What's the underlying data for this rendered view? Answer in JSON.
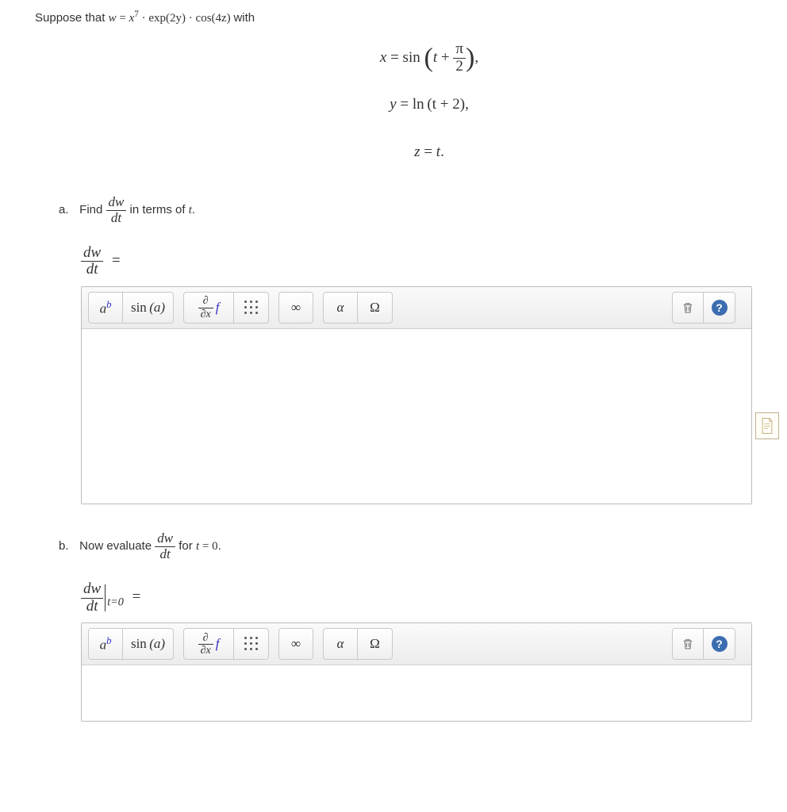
{
  "intro": {
    "prefix": "Suppose that ",
    "equation_lhs": "w",
    "equals": " = ",
    "rhs_x": "x",
    "rhs_sup": "7",
    "rhs_dot1": " · ",
    "rhs_exp": "exp",
    "rhs_exp_arg": "(2y)",
    "rhs_dot2": " · ",
    "rhs_cos": "cos",
    "rhs_cos_arg": "(4z)",
    "suffix": " with"
  },
  "equations": {
    "x_line": {
      "lhs": "x",
      "eq": " = ",
      "sin": "sin",
      "open": "(",
      "t": "t",
      "plus": " + ",
      "frac_num": "π",
      "frac_den": "2",
      "close": ")",
      "comma": ","
    },
    "y_line": {
      "lhs": "y",
      "eq": " = ",
      "ln": "ln",
      "arg": "(t + 2)",
      "comma": ","
    },
    "z_line": {
      "lhs": "z",
      "eq": " = ",
      "rhs": "t",
      "period": "."
    }
  },
  "part_a": {
    "label": "a.",
    "text_before": "Find ",
    "frac_num": "dw",
    "frac_den": "dt",
    "text_after": " in terms of ",
    "var": "t",
    "period": "."
  },
  "answer_a": {
    "frac_num": "dw",
    "frac_den": "dt",
    "equals": " = "
  },
  "part_b": {
    "label": "b.",
    "text_before": "Now evaluate ",
    "frac_num": "dw",
    "frac_den": "dt",
    "text_mid": " for ",
    "var_t": "t",
    "eq_zero": " = 0",
    "period": "."
  },
  "answer_b": {
    "frac_num": "dw",
    "frac_den": "dt",
    "sub": "t=0",
    "equals": " = "
  },
  "toolbar_labels": {
    "power_a": "a",
    "power_b": "b",
    "sin": "sin",
    "sin_arg": "(a)",
    "partial_num": "∂",
    "partial_den": "∂x",
    "partial_f": "f",
    "infinity": "∞",
    "alpha": "α",
    "Omega": "Ω",
    "help": "?"
  }
}
